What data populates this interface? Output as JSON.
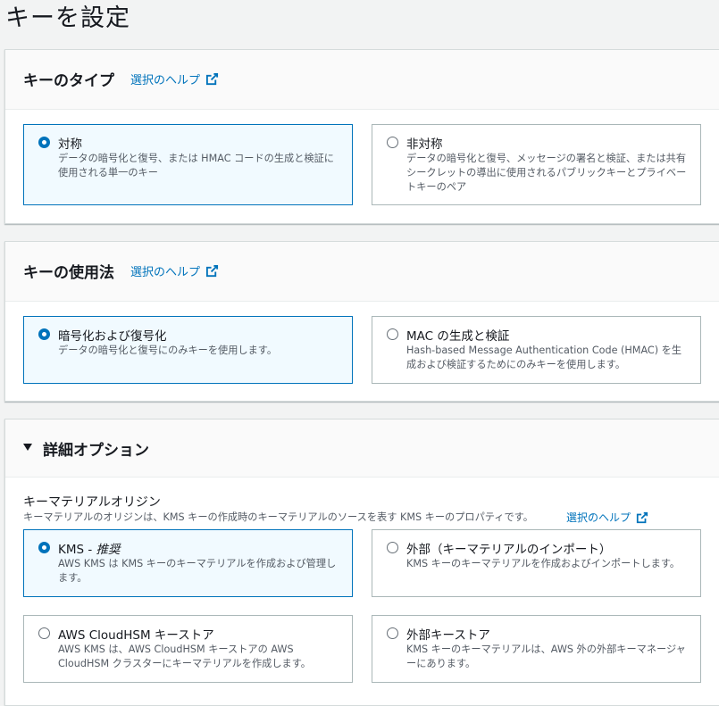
{
  "page": {
    "title": "キーを設定"
  },
  "key_type": {
    "title": "キーのタイプ",
    "help": "選択のヘルプ",
    "options": [
      {
        "label": "対称",
        "desc": "データの暗号化と復号、または HMAC コードの生成と検証に使用される単一のキー",
        "selected": true
      },
      {
        "label": "非対称",
        "desc": "データの暗号化と復号、メッセージの署名と検証、または共有シークレットの導出に使用されるパブリックキーとプライベートキーのペア",
        "selected": false
      }
    ]
  },
  "key_usage": {
    "title": "キーの使用法",
    "help": "選択のヘルプ",
    "options": [
      {
        "label": "暗号化および復号化",
        "desc": "データの暗号化と復号にのみキーを使用します。",
        "selected": true
      },
      {
        "label": "MAC の生成と検証",
        "desc": "Hash-based Message Authentication Code (HMAC) を生成および検証するためにのみキーを使用します。",
        "selected": false
      }
    ]
  },
  "advanced": {
    "title": "詳細オプション",
    "origin_label": "キーマテリアルオリジン",
    "origin_desc": "キーマテリアルのオリジンは、KMS キーの作成時のキーマテリアルのソースを表す KMS キーのプロパティです。",
    "help": "選択のヘルプ",
    "options": [
      {
        "label": "KMS - ",
        "label_em": "推奨",
        "desc": "AWS KMS は KMS キーのキーマテリアルを作成および管理します。",
        "selected": true
      },
      {
        "label": "外部（キーマテリアルのインポート）",
        "desc": "KMS キーのキーマテリアルを作成およびインポートします。",
        "selected": false
      },
      {
        "label": "AWS CloudHSM キーストア",
        "desc": "AWS KMS は、AWS CloudHSM キーストアの AWS CloudHSM クラスターにキーマテリアルを作成します。",
        "selected": false
      },
      {
        "label": "外部キーストア",
        "desc": "KMS キーのキーマテリアルは、AWS 外の外部キーマネージャーにあります。",
        "selected": false
      }
    ]
  },
  "colors": {
    "accent": "#0073bb",
    "selected_bg": "#f1faff",
    "border": "#aab7b8"
  },
  "icons": {
    "external_link": "external-link-icon",
    "caret": "caret-down-icon"
  }
}
